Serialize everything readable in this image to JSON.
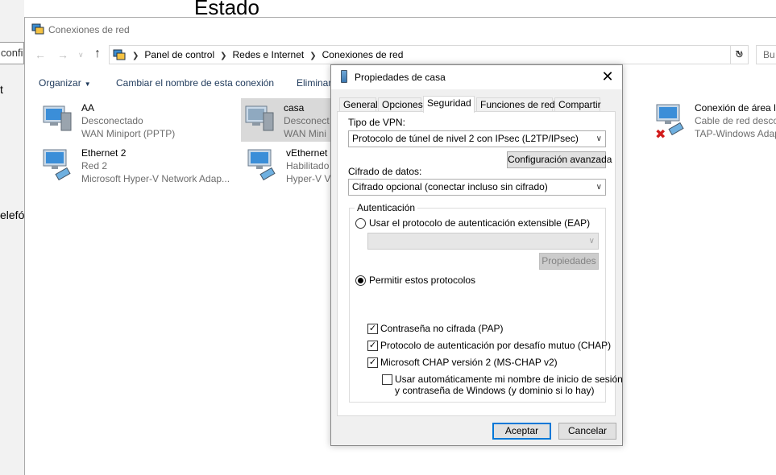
{
  "background": {
    "title_fragment": "Estado",
    "search_fragment": "confi",
    "side_text_1": "t",
    "side_text_2": "elefó"
  },
  "explorer": {
    "title": "Conexiones de red",
    "breadcrumbs": [
      "Panel de control",
      "Redes e Internet",
      "Conexiones de red"
    ],
    "search_placeholder": "Bu",
    "commands": {
      "organize": "Organizar",
      "rename": "Cambiar el nombre de esta conexión",
      "delete": "Eliminar"
    },
    "items": [
      {
        "name": "AA",
        "status": "Desconectado",
        "device": "WAN Miniport (PPTP)"
      },
      {
        "name": "casa",
        "status": "Desconect",
        "device": "WAN Mini"
      },
      {
        "name": "Conexión de área lo",
        "status": "Cable de red desco",
        "device": "TAP-Windows Adap"
      },
      {
        "name": "Ethernet 2",
        "status": "Red 2",
        "device": "Microsoft Hyper-V Network Adap..."
      },
      {
        "name": "vEthernet (",
        "status": "Habilitado",
        "device": "Hyper-V Vi"
      }
    ]
  },
  "dialog": {
    "title": "Propiedades de casa",
    "tabs": [
      "General",
      "Opciones",
      "Seguridad",
      "Funciones de red",
      "Compartir"
    ],
    "active_tab": "Seguridad",
    "vpn_type_label": "Tipo de VPN:",
    "vpn_type_value": "Protocolo de túnel de nivel 2 con IPsec (L2TP/IPsec)",
    "advanced_button": "Configuración avanzada",
    "encryption_label": "Cifrado de datos:",
    "encryption_value": "Cifrado opcional (conectar incluso sin cifrado)",
    "auth_group": "Autenticación",
    "eap_radio": "Usar el protocolo de autenticación extensible (EAP)",
    "eap_selected": false,
    "properties_button": "Propiedades",
    "allow_radio": "Permitir estos protocolos",
    "allow_selected": true,
    "checks": [
      {
        "label": "Contraseña no cifrada (PAP)",
        "checked": true
      },
      {
        "label": "Protocolo de autenticación por desafío mutuo (CHAP)",
        "checked": true
      },
      {
        "label": "Microsoft CHAP versión 2 (MS-CHAP v2)",
        "checked": true
      }
    ],
    "auto_logon_line1": "Usar automáticamente mi nombre de inicio de sesión",
    "auto_logon_line2": "y contraseña de Windows (y dominio si lo hay)",
    "auto_logon_checked": false,
    "ok_button": "Aceptar",
    "cancel_button": "Cancelar"
  }
}
